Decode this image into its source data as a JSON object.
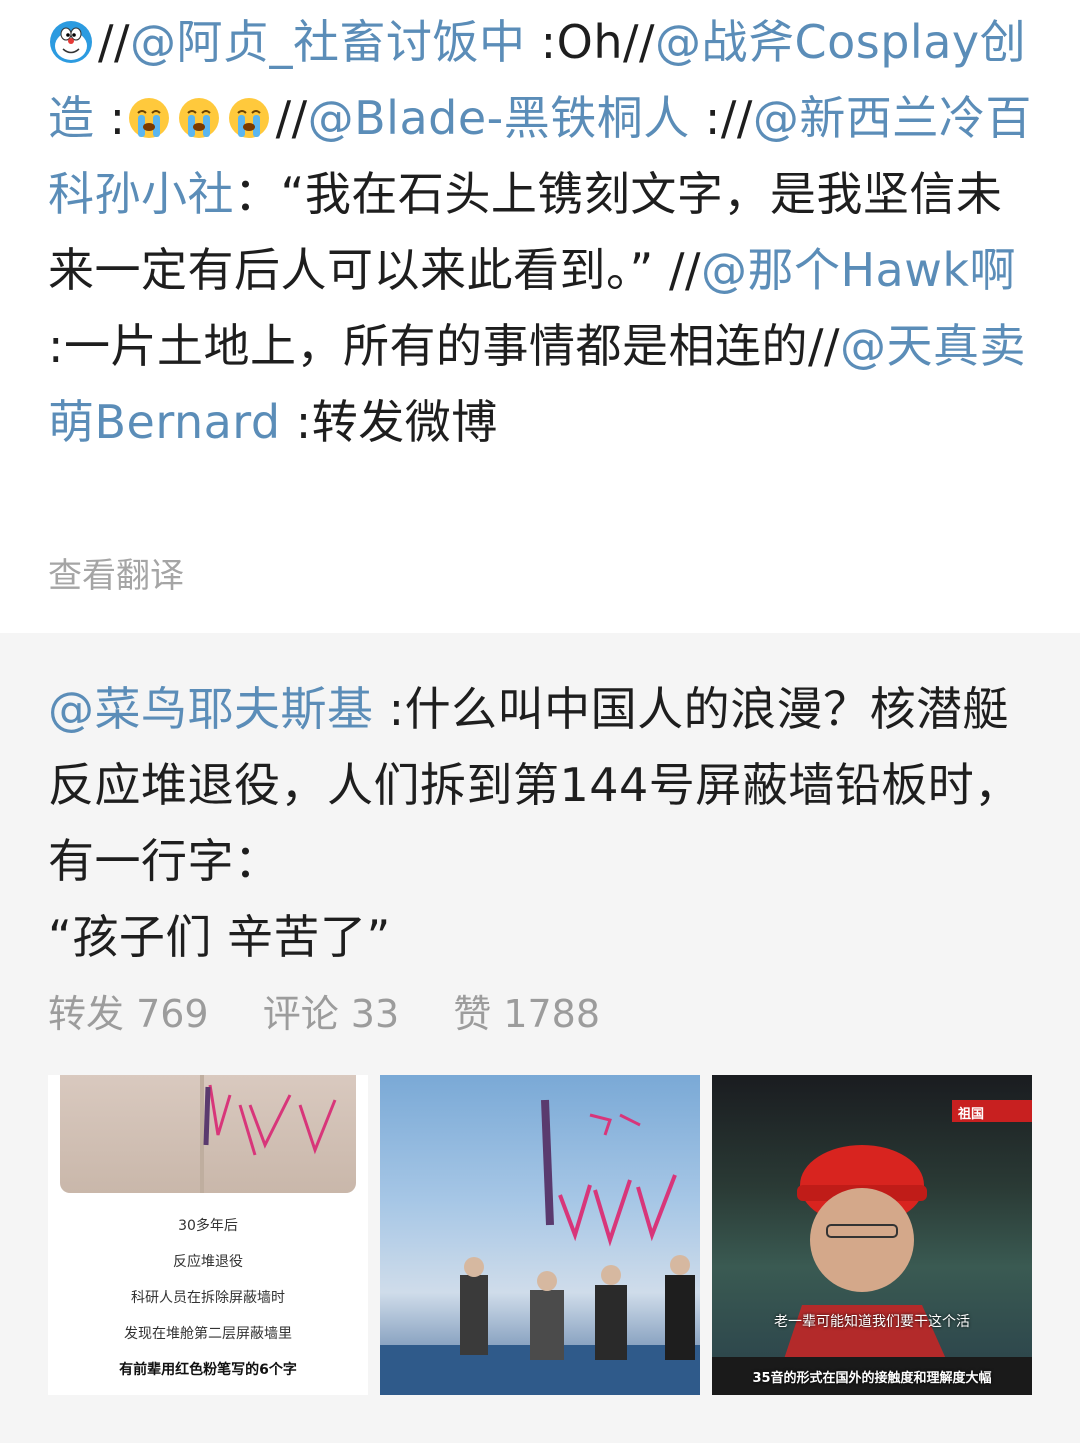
{
  "repost": {
    "segments": [
      {
        "t": "//",
        "m": false
      },
      {
        "t": "@阿贞_社畜讨饭中",
        "m": true
      },
      {
        "t": " :Oh//",
        "m": false
      },
      {
        "t": "@战斧Cosplay创造",
        "m": true
      },
      {
        "t": " :",
        "m": false
      },
      {
        "t": "//",
        "m": false
      },
      {
        "t": "@Blade-黑铁桐人",
        "m": true
      },
      {
        "t": " ://",
        "m": false
      },
      {
        "t": "@新西兰冷百科孙小社",
        "m": true
      },
      {
        "t": "：“我在石头上镌刻文字，是我坚信未来一定有后人可以来此看到。” //",
        "m": false
      },
      {
        "t": "@那个Hawk啊",
        "m": true
      },
      {
        "t": " :一片土地上，所有的事情都是相连的//",
        "m": false
      },
      {
        "t": "@天真卖萌Bernard",
        "m": true
      },
      {
        "t": " :转发微博",
        "m": false
      }
    ],
    "translate_label": "查看翻译"
  },
  "original": {
    "mention": "@菜鸟耶夫斯基",
    "body": " :什么叫中国人的浪漫？核潜艇反应堆退役，人们拆到第144号屏蔽墙铅板时，有一行字：",
    "quote": " “孩子们 辛苦了”",
    "stats": {
      "repost": "转发 769",
      "comment": "评论 33",
      "like": "赞 1788"
    },
    "images": [
      {
        "captions": [
          "30多年后",
          "反应堆退役",
          "科研人员在拆除屏蔽墙时",
          "发现在堆舱第二层屏蔽墙里",
          "有前辈用红色粉笔写的6个字"
        ]
      },
      {
        "captions": []
      },
      {
        "overlay": "老一辈可能知道我们要干这个活",
        "bottom": "35音的形式在国外的接触度和理解度大幅",
        "tag": "祖国"
      }
    ]
  },
  "icons": {
    "doraemon": "doraemon-emoji-icon",
    "cry": "crying-emoji-icon"
  }
}
